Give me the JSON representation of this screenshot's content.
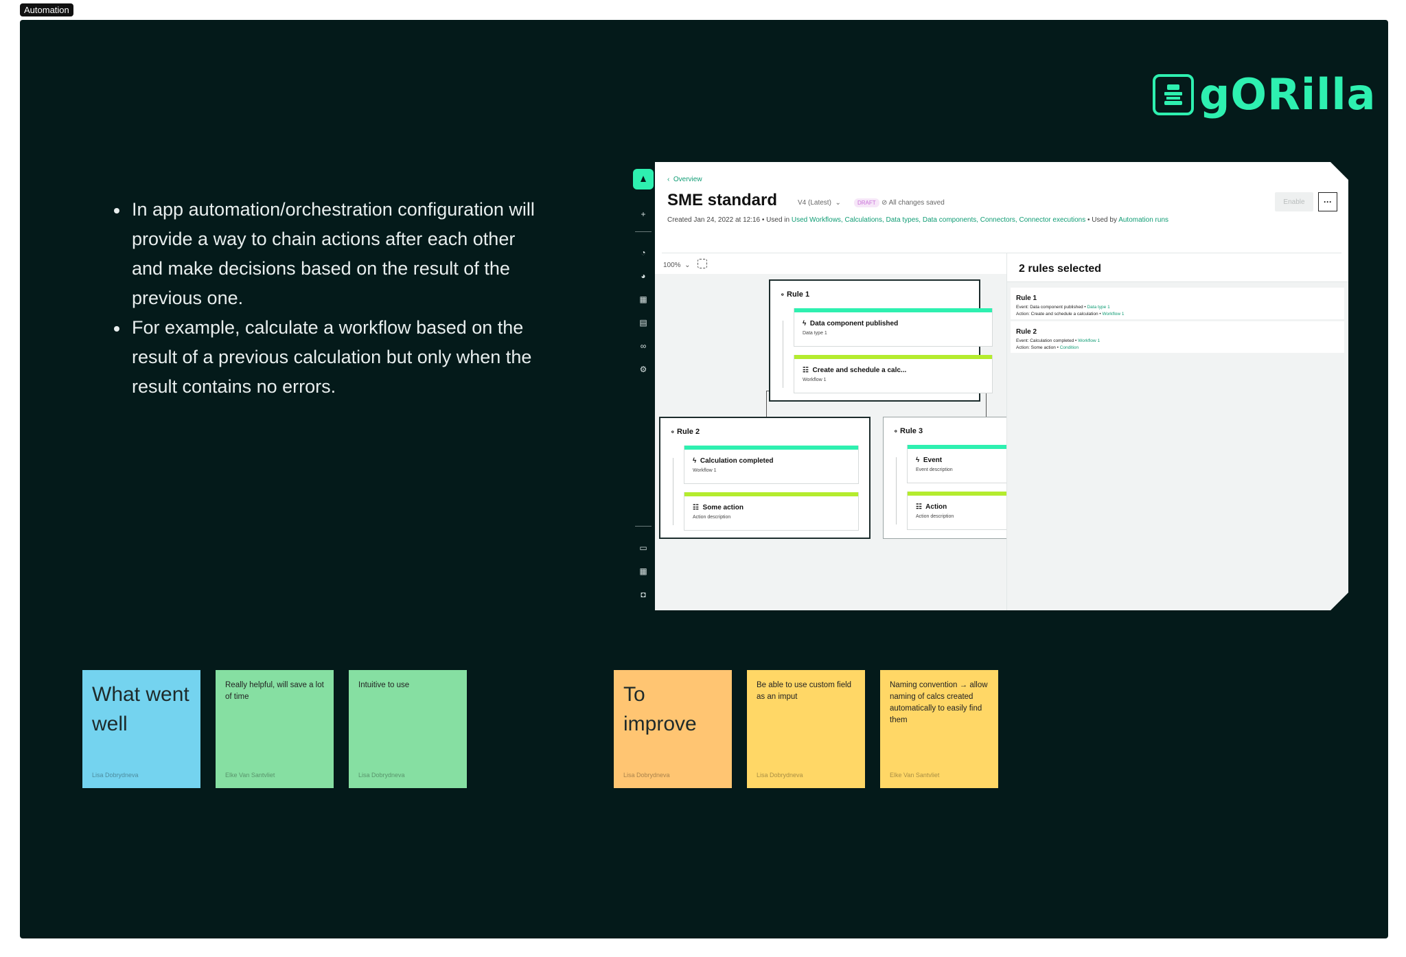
{
  "frame_tag": "Automation",
  "logo": {
    "wordmark": "gORilla",
    "color": "#2ef0b0"
  },
  "bullets": [
    "In app automation/orchestration configuration will  provide a way to chain actions after each other and make decisions based on the result of the previous one.",
    "For example, calculate a workflow based on the result of a previous calculation but only when the result contains no errors."
  ],
  "app": {
    "back_link": "Overview",
    "title": "SME standard",
    "version": "V4 (Latest)",
    "draft_badge": "DRAFT",
    "save_status": "All changes saved",
    "meta_prefix": "Created Jan 24, 2022 at 12:16 • Used in ",
    "meta_links": "Used Workflows, Calculations, Data types, Data components, Connectors, Connector executions",
    "meta_mid": " • Used by ",
    "meta_link2": "Automation runs",
    "enable_button": "Enable",
    "more_button": "···",
    "zoom": "100%",
    "rules": [
      {
        "title": "Rule 1",
        "event": {
          "title": "Data component published",
          "sub": "Data type 1"
        },
        "action": {
          "title": "Create and schedule a calc...",
          "sub": "Workflow 1"
        }
      },
      {
        "title": "Rule 2",
        "event": {
          "title": "Calculation completed",
          "sub": "Workflow 1"
        },
        "action": {
          "title": "Some action",
          "sub": "Action description"
        }
      },
      {
        "title": "Rule 3",
        "event": {
          "title": "Event",
          "sub": "Event description"
        },
        "action": {
          "title": "Action",
          "sub": "Action description"
        }
      }
    ],
    "side_panel": {
      "title": "2 rules selected",
      "items": [
        {
          "name": "Rule 1",
          "event_label": "Event: Data component published",
          "event_link": "Data type 1",
          "action_label": "Action: Create and schedule a calculation",
          "action_link": "Workflow 1"
        },
        {
          "name": "Rule 2",
          "event_label": "Event: Calculation completed",
          "event_link": "Workflow 1",
          "action_label": "Action: Some action",
          "action_link": "Condition"
        }
      ]
    }
  },
  "stickies": [
    {
      "text": "What went well",
      "author": "Lisa Dobrydneva",
      "color": "#74d3ef",
      "style": "heading"
    },
    {
      "text": "Really helpful, will save a lot of time",
      "author": "Elke Van Santvliet",
      "color": "#86dfa2",
      "style": "note"
    },
    {
      "text": "Intuitive to use",
      "author": "Lisa Dobrydneva",
      "color": "#86dfa2",
      "style": "note"
    },
    {
      "text": "To improve",
      "author": "Lisa Dobrydneva",
      "color": "#ffc572",
      "style": "heading"
    },
    {
      "text": "Be able to use custom field as an imput",
      "author": "Lisa Dobrydneva",
      "color": "#ffd766",
      "style": "note"
    },
    {
      "text": "Naming convention → allow naming of calcs created automatically to easily find them",
      "author": "Elke Van Santvliet",
      "color": "#ffd766",
      "style": "note"
    }
  ]
}
